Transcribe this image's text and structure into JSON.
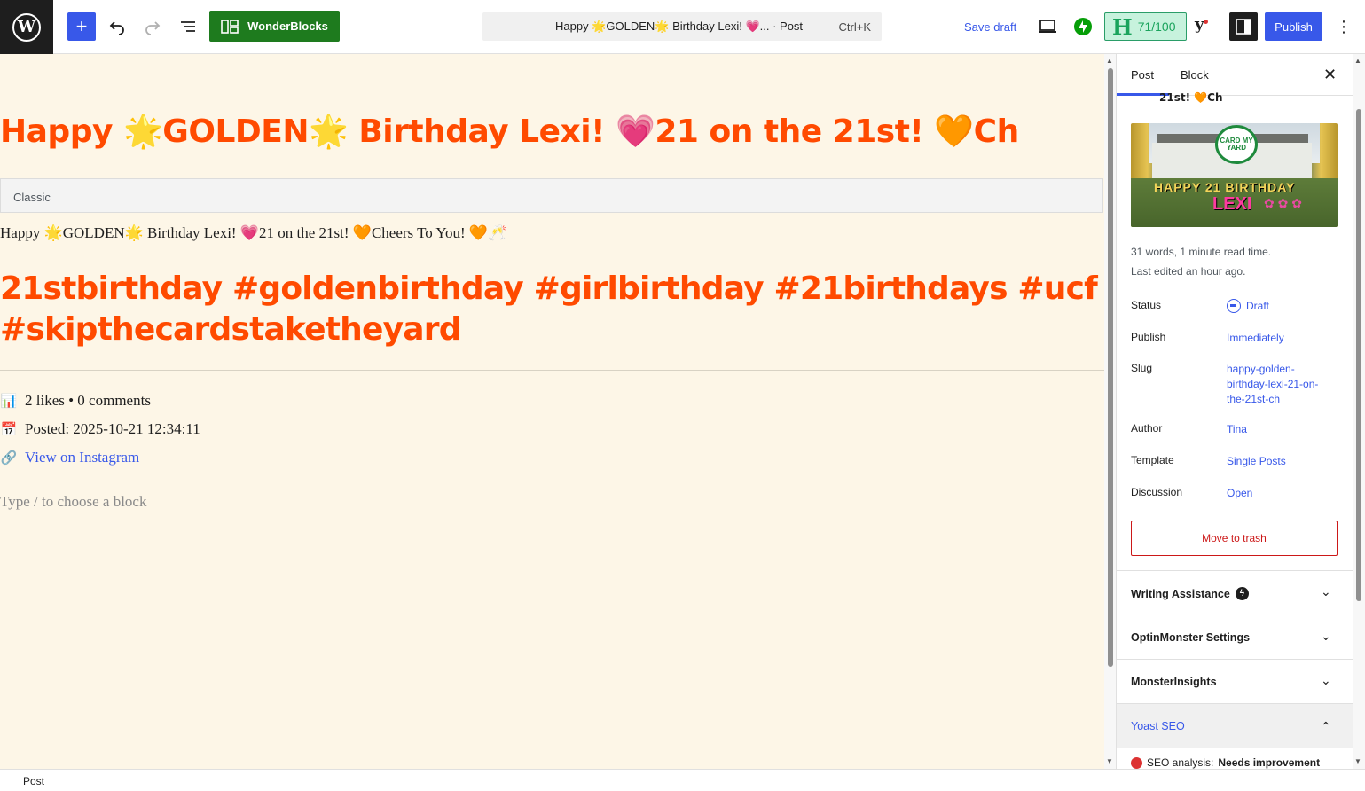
{
  "topbar": {
    "wonderblocks_label": "WonderBlocks",
    "command_title": "Happy 🌟GOLDEN🌟 Birthday Lexi! 💗... · Post",
    "command_shortcut": "Ctrl+K",
    "save_draft": "Save draft",
    "hemingway_score": "71/100",
    "publish": "Publish"
  },
  "editor": {
    "title": "Happy 🌟GOLDEN🌟 Birthday Lexi! 💗21 on the 21st! 🧡Ch",
    "classic_label": "Classic",
    "classic_text": "Happy 🌟GOLDEN🌟 Birthday Lexi! 💗21 on the 21st! 🧡Cheers To You! 🧡🥂",
    "hashtags_line1": "21stbirthday #goldenbirthday #girlbirthday #21birthdays #ucf",
    "hashtags_line2": "#skipthecardstaketheyard",
    "likes": "2 likes • 0 comments",
    "posted": "Posted: 2025-10-21 12:34:11",
    "instagram_link": "View on Instagram",
    "placeholder": "Type / to choose a block"
  },
  "sidebar": {
    "tab_post": "Post",
    "tab_block": "Block",
    "scrolled_title": "21st! 🧡Ch",
    "featured_badge": "CARD MY YARD",
    "featured_sign": "HAPPY 21 BIRTHDAY",
    "featured_name": "LEXI",
    "words": "31 words, 1 minute read time.",
    "last_edited": "Last edited an hour ago.",
    "rows": [
      {
        "label": "Status",
        "value": "Draft"
      },
      {
        "label": "Publish",
        "value": "Immediately"
      },
      {
        "label": "Slug",
        "value": "happy-golden-birthday-lexi-21-on-the-21st-ch"
      },
      {
        "label": "Author",
        "value": "Tina"
      },
      {
        "label": "Template",
        "value": "Single Posts"
      },
      {
        "label": "Discussion",
        "value": "Open"
      }
    ],
    "trash": "Move to trash",
    "panels": [
      "Writing Assistance",
      "OptinMonster Settings",
      "MonsterInsights",
      "Yoast SEO"
    ],
    "seo_label": "SEO analysis:",
    "seo_value": "Needs improvement"
  },
  "footer": {
    "breadcrumb": "Post"
  }
}
